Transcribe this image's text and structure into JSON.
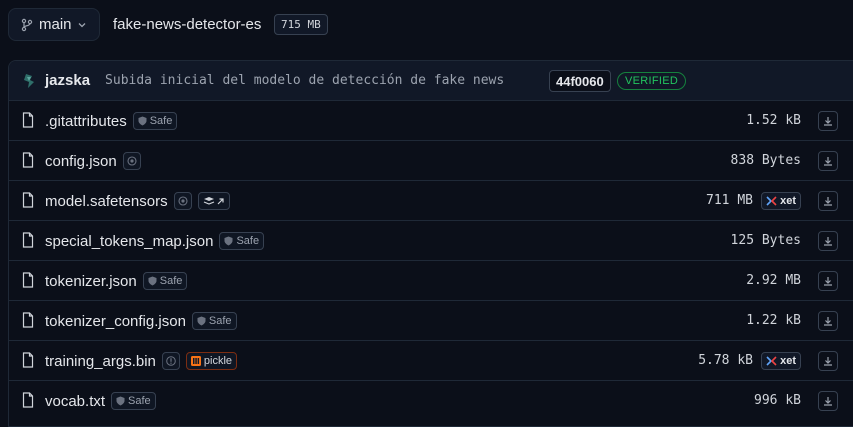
{
  "header": {
    "branch_label": "main",
    "repo_name": "fake-news-detector-es",
    "repo_size": "715 MB"
  },
  "commit": {
    "user": "jazska",
    "message": "Subida inicial del modelo de detección de fake news",
    "hash": "44f0060",
    "verified_label": "VERIFIED"
  },
  "files": [
    {
      "name": ".gitattributes",
      "tag": "Safe",
      "size": "1.52 kB"
    },
    {
      "name": "config.json",
      "size": "838 Bytes"
    },
    {
      "name": "model.safetensors",
      "size": "711 MB",
      "xet": "xet"
    },
    {
      "name": "special_tokens_map.json",
      "tag": "Safe",
      "size": "125 Bytes"
    },
    {
      "name": "tokenizer.json",
      "tag": "Safe",
      "size": "2.92 MB"
    },
    {
      "name": "tokenizer_config.json",
      "tag": "Safe",
      "size": "1.22 kB"
    },
    {
      "name": "training_args.bin",
      "tag": "pickle",
      "size": "5.78 kB",
      "xet": "xet"
    },
    {
      "name": "vocab.txt",
      "tag": "Safe",
      "size": "996 kB"
    }
  ],
  "colors": {
    "background": "#0b0f19",
    "verified": "#22c55e",
    "pickle_accent": "#f97316"
  }
}
